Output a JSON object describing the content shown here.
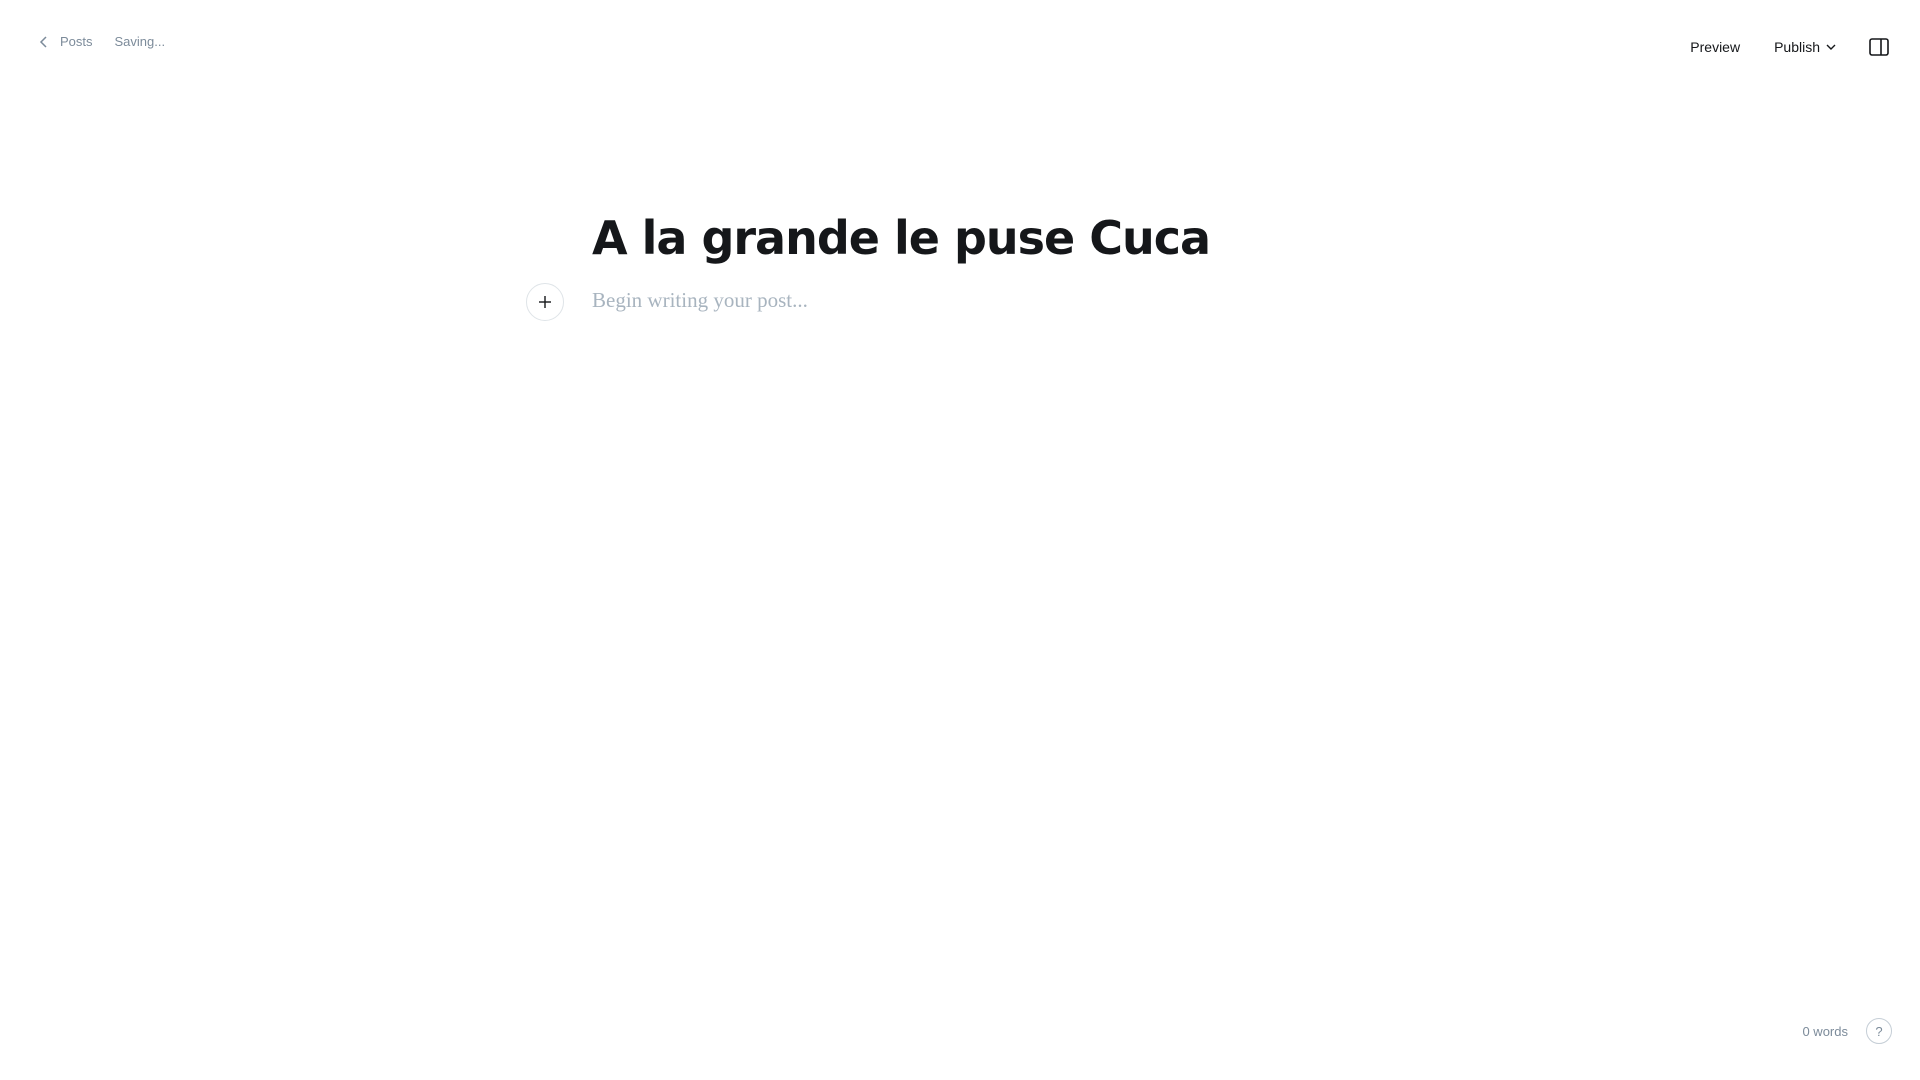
{
  "topbar": {
    "back_label": "Posts",
    "status": "Saving...",
    "preview_label": "Preview",
    "publish_label": "Publish"
  },
  "editor": {
    "title": "A la grande le puse Cuca",
    "body_placeholder": "Begin writing your post..."
  },
  "footer": {
    "word_count": "0 words",
    "help_label": "?"
  },
  "icons": {
    "back": "chevron-left-icon",
    "publish_caret": "chevron-down-icon",
    "settings": "sidebar-panel-icon",
    "add_card": "plus-icon"
  },
  "colors": {
    "text": "#15171a",
    "muted": "#7c8b9a",
    "placeholder": "#a8b4bf",
    "border": "#dfe4e8"
  }
}
